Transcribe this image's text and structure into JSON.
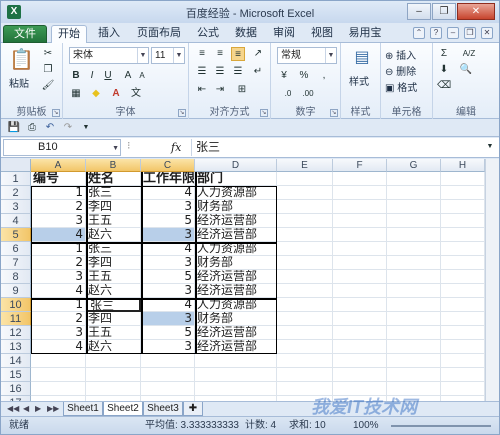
{
  "window": {
    "title": "百度经验 - Microsoft Excel",
    "minimize": "–",
    "restore": "❐",
    "close": "✕"
  },
  "tabs": [
    "文件",
    "开始",
    "插入",
    "页面布局",
    "公式",
    "数据",
    "审阅",
    "视图",
    "易用宝"
  ],
  "ribbon": {
    "clipboard": {
      "label": "剪贴板",
      "paste": "粘贴"
    },
    "font": {
      "label": "字体",
      "name": "宋体",
      "size": "11",
      "bold": "B",
      "italic": "I",
      "underline": "U",
      "grow": "A",
      "shrink": "A"
    },
    "alignment": {
      "label": "对齐方式"
    },
    "number": {
      "label": "数字",
      "format": "常规",
      "percent": "%",
      "comma": ","
    },
    "styles": {
      "label": "样式",
      "button": "样式"
    },
    "cells": {
      "label": "单元格",
      "insert": "插入",
      "delete": "删除",
      "format": "格式"
    },
    "editing": {
      "label": "编辑",
      "sum": "Σ",
      "sort": "A/Z"
    }
  },
  "formula_bar": {
    "name_box": "B10",
    "fx": "fx",
    "value": "张三"
  },
  "columns": [
    "A",
    "B",
    "C",
    "D",
    "E",
    "F",
    "G",
    "H"
  ],
  "rows": [
    [
      "编号",
      "姓名",
      "工作年限",
      "部门"
    ],
    [
      "1",
      "张三",
      "4",
      "人力资源部"
    ],
    [
      "2",
      "李四",
      "3",
      "财务部"
    ],
    [
      "3",
      "王五",
      "5",
      "经济运营部"
    ],
    [
      "4",
      "赵六",
      "3",
      "经济运营部"
    ],
    [
      "1",
      "张三",
      "4",
      "人力资源部"
    ],
    [
      "2",
      "李四",
      "3",
      "财务部"
    ],
    [
      "3",
      "王五",
      "5",
      "经济运营部"
    ],
    [
      "4",
      "赵六",
      "3",
      "经济运营部"
    ],
    [
      "1",
      "张三",
      "4",
      "人力资源部"
    ],
    [
      "2",
      "李四",
      "3",
      "财务部"
    ],
    [
      "3",
      "王五",
      "5",
      "经济运营部"
    ],
    [
      "4",
      "赵六",
      "3",
      "经济运营部"
    ],
    [
      "",
      "",
      "",
      ""
    ],
    [
      "",
      "",
      "",
      ""
    ],
    [
      "",
      "",
      "",
      ""
    ],
    [
      "",
      "",
      "",
      ""
    ]
  ],
  "row_numbers": [
    "1",
    "2",
    "3",
    "4",
    "5",
    "6",
    "7",
    "8",
    "9",
    "10",
    "11",
    "12",
    "13",
    "14",
    "15",
    "16",
    "17"
  ],
  "sheets": [
    "Sheet1",
    "Sheet2",
    "Sheet3"
  ],
  "status": {
    "ready": "就绪",
    "average": "平均值: 3.333333333",
    "count": "计数: 4",
    "sum": "求和: 10",
    "zoom": "100%"
  },
  "watermark": "我爱IT技术网"
}
